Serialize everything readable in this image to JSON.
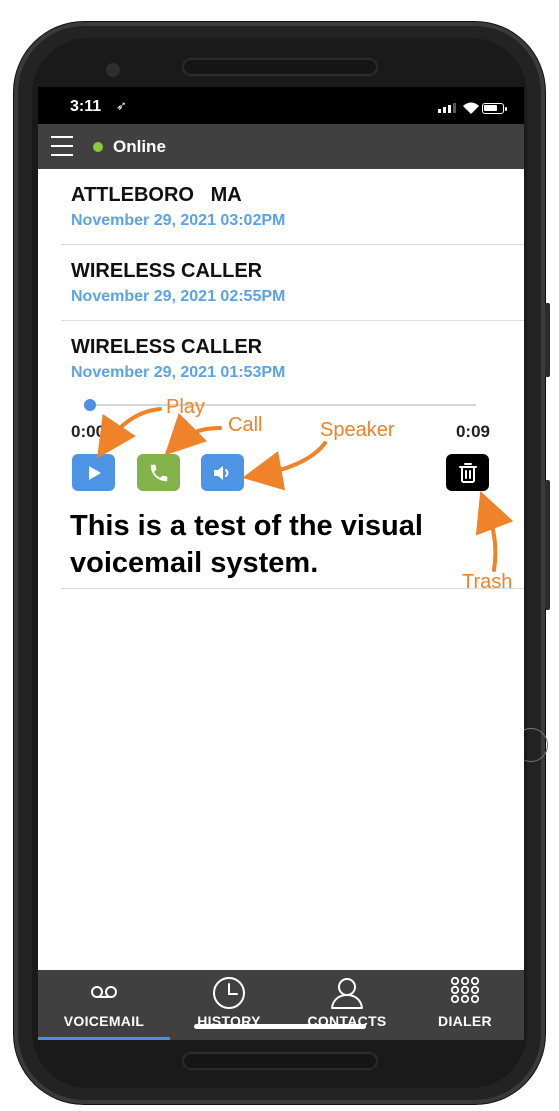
{
  "status_bar": {
    "time": "3:11",
    "location_glyph": "➶"
  },
  "app_bar": {
    "menu_icon": "hamburger-icon",
    "status": "Online",
    "status_color": "#8cc83f"
  },
  "voicemails": [
    {
      "caller": "ATTLEBORO   MA",
      "date": "November 29, 2021 03:02PM"
    },
    {
      "caller": "WIRELESS CALLER",
      "date": "November 29, 2021 02:55PM"
    },
    {
      "caller": "WIRELESS CALLER",
      "date": "November 29, 2021 01:53PM"
    }
  ],
  "player": {
    "elapsed": "0:00",
    "total": "0:09",
    "progress": 0.0,
    "transcript": "This is a test of the visual voicemail system."
  },
  "annotations": {
    "play": "Play",
    "call": "Call",
    "speaker": "Speaker",
    "trash": "Trash",
    "color": "#f0822a"
  },
  "tabs": [
    {
      "label": "VOICEMAIL",
      "icon": "voicemail-icon",
      "active": true
    },
    {
      "label": "HISTORY",
      "icon": "clock-icon",
      "active": false
    },
    {
      "label": "CONTACTS",
      "icon": "person-icon",
      "active": false
    },
    {
      "label": "DIALER",
      "icon": "dialpad-icon",
      "active": false
    }
  ],
  "colors": {
    "accent": "#4a90e2",
    "date_text": "#5aa3ec",
    "call_button": "#82b24a",
    "bar_background": "#404040"
  }
}
